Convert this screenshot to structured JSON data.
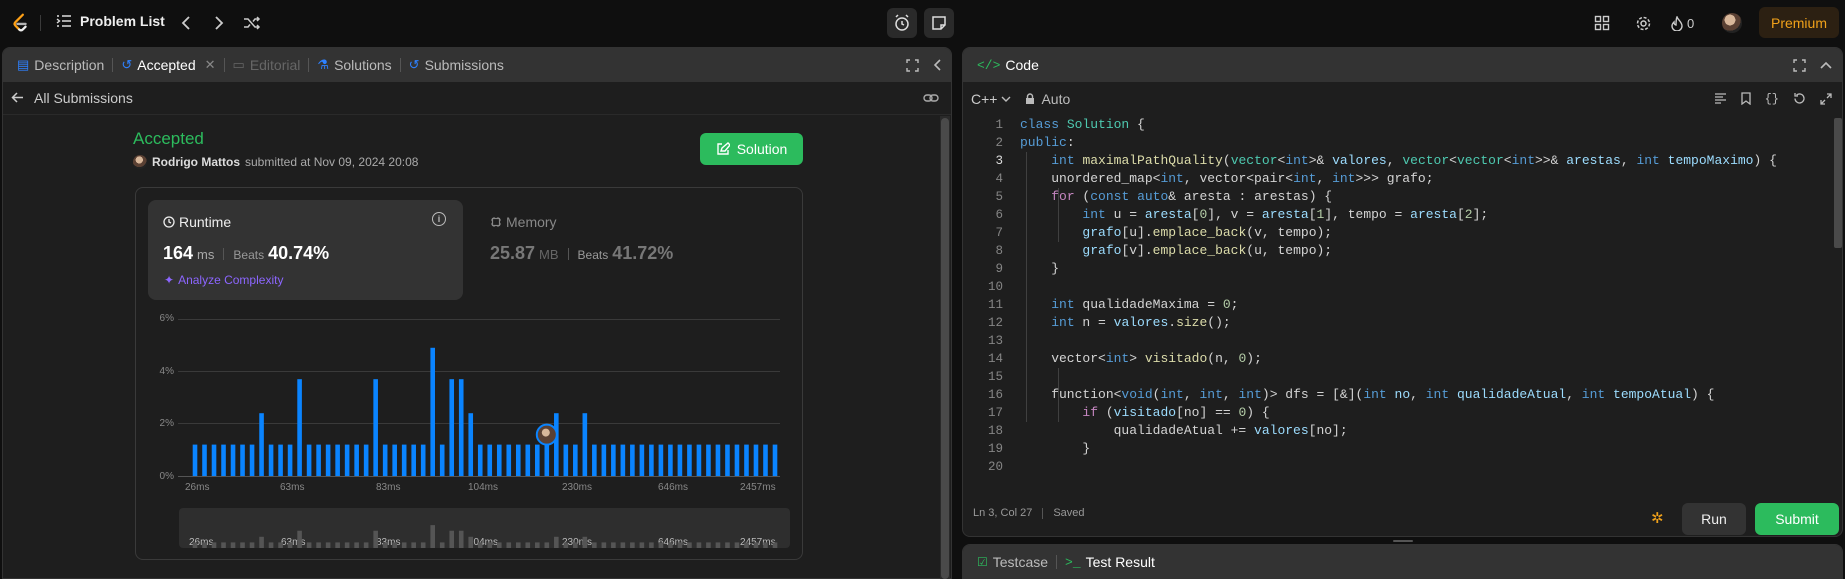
{
  "topbar": {
    "problem_list": "Problem List",
    "fire_count": "0",
    "premium": "Premium"
  },
  "left_tabs": {
    "description": "Description",
    "accepted": "Accepted",
    "editorial": "Editorial",
    "solutions": "Solutions",
    "submissions": "Submissions"
  },
  "subbar": {
    "back_label": "All Submissions"
  },
  "submission": {
    "status": "Accepted",
    "user": "Rodrigo Mattos",
    "submitted_text": "submitted at Nov 09, 2024 20:08",
    "solution_button": "Solution"
  },
  "runtime": {
    "title": "Runtime",
    "value": "164",
    "unit": "ms",
    "beats_label": "Beats",
    "beats_value": "40.74%",
    "analyze": "Analyze Complexity"
  },
  "memory": {
    "title": "Memory",
    "value": "25.87",
    "unit": "MB",
    "beats_label": "Beats",
    "beats_value": "41.72%"
  },
  "chart_data": {
    "type": "bar",
    "y_ticks": [
      "6%",
      "4%",
      "2%",
      "0%"
    ],
    "ylim": [
      0,
      6
    ],
    "x_tick_labels": [
      "26ms",
      "63ms",
      "83ms",
      "104ms",
      "230ms",
      "646ms",
      "2457ms"
    ],
    "values": [
      1.2,
      1.2,
      1.2,
      1.2,
      1.2,
      1.2,
      1.2,
      2.4,
      1.2,
      1.2,
      1.2,
      3.7,
      1.2,
      1.2,
      1.2,
      1.2,
      1.2,
      1.2,
      1.2,
      3.7,
      1.2,
      1.2,
      1.2,
      1.2,
      1.2,
      4.9,
      1.2,
      3.7,
      3.7,
      2.4,
      1.2,
      1.2,
      1.2,
      1.2,
      1.2,
      1.2,
      1.2,
      1.2,
      2.4,
      1.2,
      1.2,
      2.4,
      1.2,
      1.2,
      1.2,
      1.2,
      1.2,
      1.2,
      1.2,
      1.2,
      1.2,
      1.2,
      1.2,
      1.2,
      1.2,
      1.2,
      1.2,
      1.2,
      1.2,
      1.2,
      1.2,
      1.2
    ],
    "user_bar_index": 37,
    "bar_color": "#0a84ff"
  },
  "code_panel": {
    "title": "Code",
    "language": "C++",
    "mode": "Auto",
    "status_pos": "Ln 3, Col 27",
    "status_saved": "Saved",
    "run": "Run",
    "submit": "Submit",
    "current_line": 3
  },
  "code_lines": [
    "1",
    "2",
    "3",
    "4",
    "5",
    "6",
    "7",
    "8",
    "9",
    "10",
    "11",
    "12",
    "13",
    "14",
    "15",
    "16",
    "17",
    "18",
    "19",
    "20"
  ],
  "test_tabs": {
    "testcase": "Testcase",
    "result": "Test Result"
  }
}
